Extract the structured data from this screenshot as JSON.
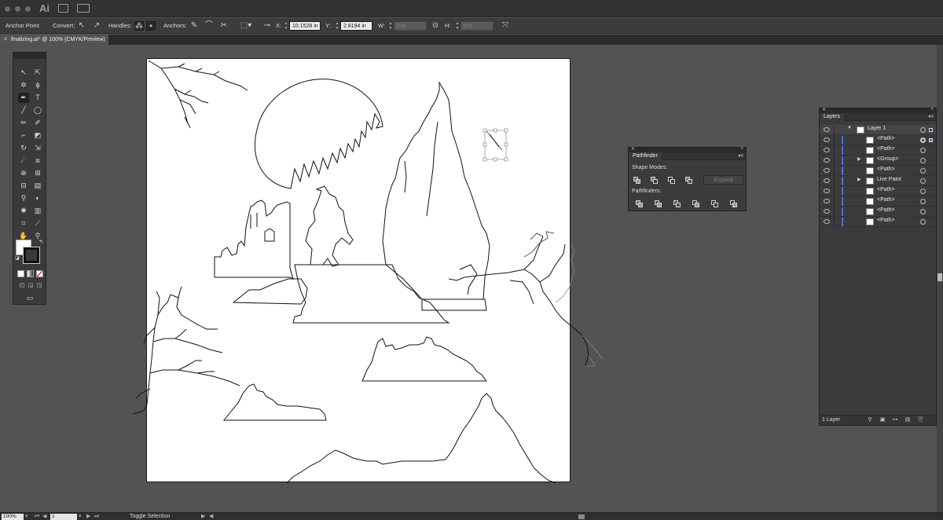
{
  "app": {
    "logo": "Ai"
  },
  "control_bar": {
    "anchor_point": "Anchor Point",
    "convert_label": "Convert:",
    "handles_label": "Handles:",
    "anchors_label": "Anchors:",
    "x_label": "X:",
    "x_value": "10.1528 in",
    "y_label": "Y:",
    "y_value": "2.8194 in",
    "w_label": "W:",
    "w_value": "0 in",
    "h_label": "H:",
    "h_value": "0 in"
  },
  "document": {
    "tab_title": "finalizing.ai* @ 100% (CMYK/Preview)"
  },
  "tools": {
    "type_tool": "T"
  },
  "pathfinder": {
    "title": "Pathfinder",
    "shape_modes_label": "Shape Modes:",
    "expand_label": "Expand",
    "pathfinders_label": "Pathfinders:"
  },
  "layers": {
    "title": "Layers",
    "rows": [
      {
        "name": "Layer 1"
      },
      {
        "name": "<Path>"
      },
      {
        "name": "<Path>"
      },
      {
        "name": "<Group>"
      },
      {
        "name": "<Path>"
      },
      {
        "name": "Live Paint"
      },
      {
        "name": "<Path>"
      },
      {
        "name": "<Path>"
      },
      {
        "name": "<Path>"
      },
      {
        "name": "<Path>"
      }
    ],
    "count_label": "1 Layer"
  },
  "status_bar": {
    "zoom": "100%",
    "page": "1",
    "status_text": "Toggle Selection"
  },
  "colors": {
    "panel_bg": "#3b3b3b",
    "pasteboard": "#535353",
    "layer_color": "#4f6fd6"
  }
}
